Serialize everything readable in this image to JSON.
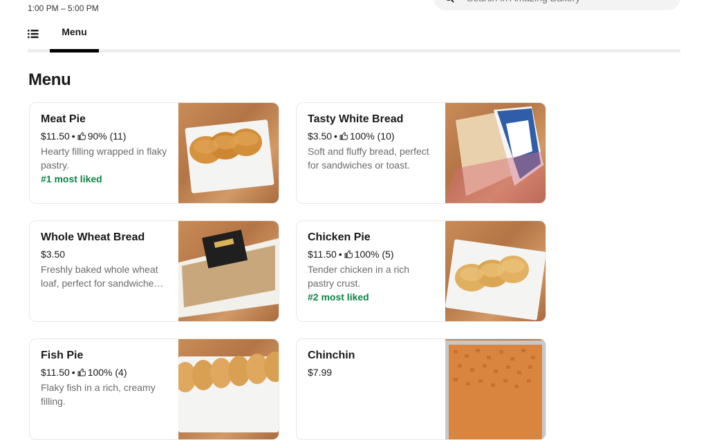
{
  "store": {
    "hours": "1:00 PM – 5:00 PM",
    "search_placeholder": "Search in Amazing Bakery"
  },
  "tabs": {
    "menu_label": "Menu"
  },
  "menu": {
    "title": "Menu",
    "items": [
      {
        "name": "Meat Pie",
        "price": "$11.50",
        "sep": "•",
        "rating": "90% (11)",
        "description": "Hearty filling wrapped in flaky pastry.",
        "badge": "#1 most liked"
      },
      {
        "name": "Tasty White Bread",
        "price": "$3.50",
        "sep": "•",
        "rating": "100% (10)",
        "description": "Soft and fluffy bread, perfect for sandwiches or toast.",
        "badge": ""
      },
      {
        "name": "Whole Wheat Bread",
        "price": "$3.50",
        "sep": "",
        "rating": "",
        "description": "Freshly baked whole wheat loaf, perfect for sandwiches and toast.",
        "badge": ""
      },
      {
        "name": "Chicken Pie",
        "price": "$11.50",
        "sep": "•",
        "rating": "100% (5)",
        "description": "Tender chicken in a rich pastry crust.",
        "badge": "#2 most liked"
      },
      {
        "name": "Fish Pie",
        "price": "$11.50",
        "sep": "•",
        "rating": "100% (4)",
        "description": "Flaky fish in a rich, creamy filling.",
        "badge": ""
      },
      {
        "name": "Chinchin",
        "price": "$7.99",
        "sep": "",
        "rating": "",
        "description": "",
        "badge": ""
      }
    ]
  },
  "icons": {
    "search": "search-icon",
    "list": "list-icon",
    "thumbs_up": "thumbs-up-icon"
  },
  "colors": {
    "badge": "#0e8345",
    "tab_underline": "#000000",
    "description": "#6b6b6b"
  }
}
